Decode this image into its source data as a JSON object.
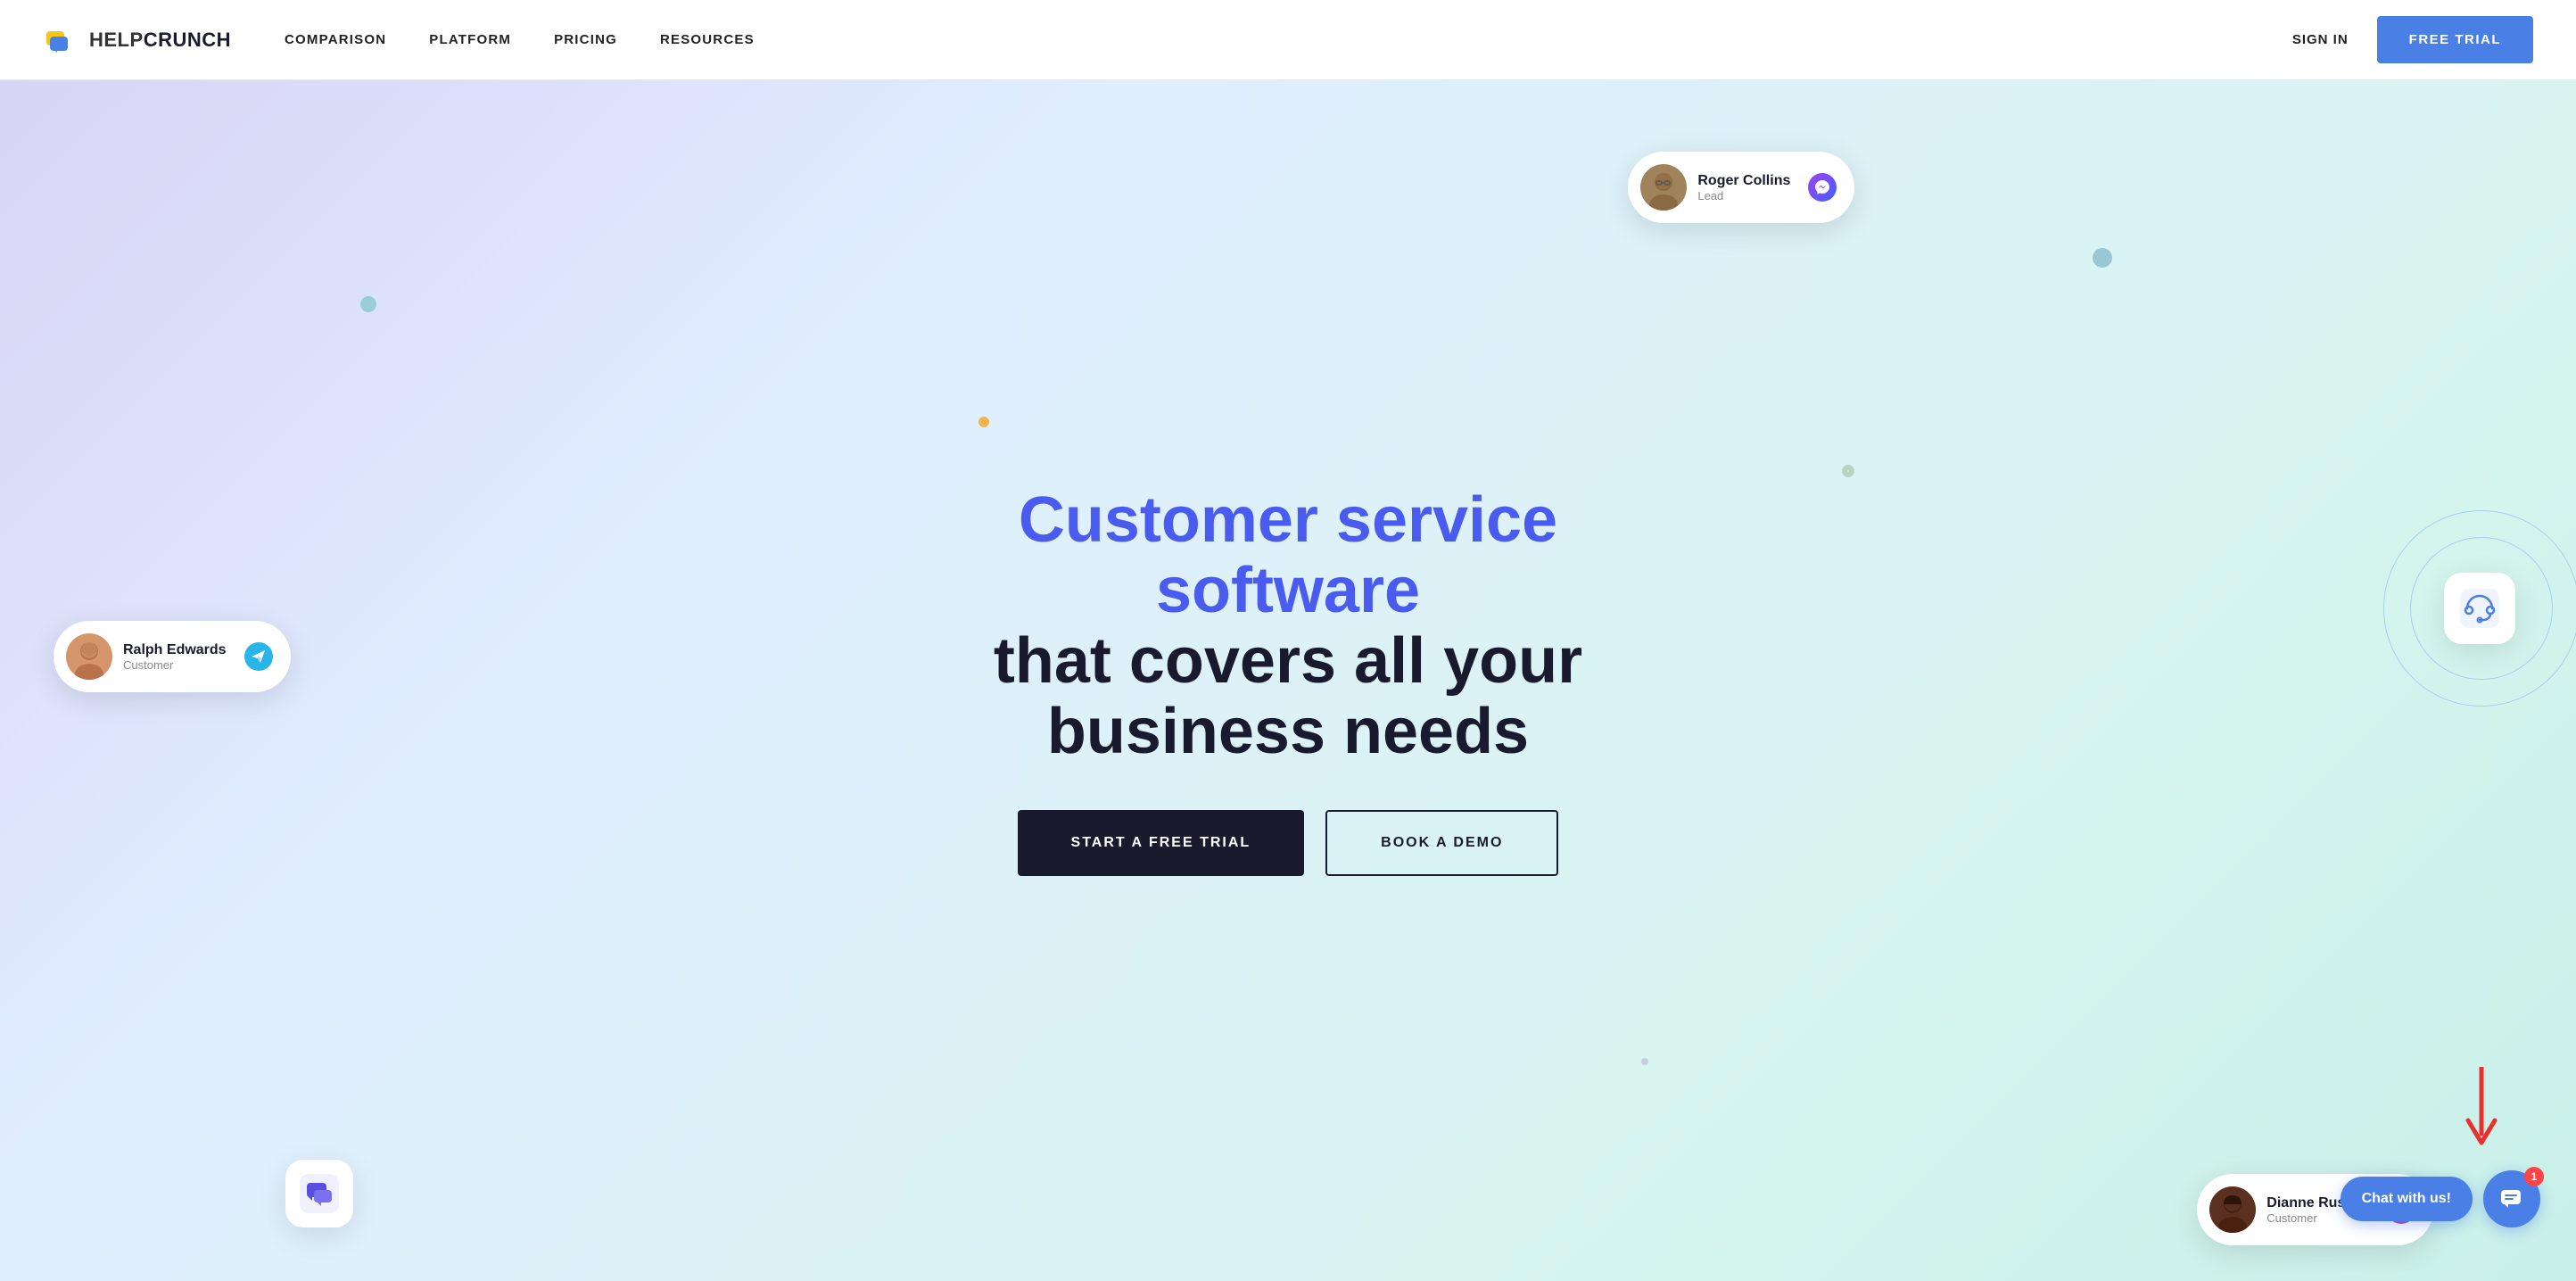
{
  "navbar": {
    "logo_text_help": "HELP",
    "logo_text_crunch": "CRUNCH",
    "nav_items": [
      {
        "label": "COMPARISON",
        "href": "#"
      },
      {
        "label": "PLATFORM",
        "href": "#"
      },
      {
        "label": "PRICING",
        "href": "#"
      },
      {
        "label": "RESOURCES",
        "href": "#"
      }
    ],
    "sign_in_label": "SIGN IN",
    "free_trial_label": "FREE TRIAL"
  },
  "hero": {
    "title_line1": "Customer service software",
    "title_line2": "that covers all your",
    "title_line3": "business needs",
    "cta_primary": "START A FREE TRIAL",
    "cta_secondary": "BOOK A DEMO"
  },
  "cards": {
    "ralph": {
      "name": "Ralph Edwards",
      "role": "Customer",
      "icon": "telegram",
      "avatar_emoji": "😊"
    },
    "roger": {
      "name": "Roger Collins",
      "role": "Lead",
      "icon": "messenger",
      "avatar_emoji": "👨"
    },
    "dianne": {
      "name": "Dianne Russell",
      "role": "Customer",
      "icon": "instagram",
      "avatar_emoji": "👩"
    }
  },
  "chat_widget": {
    "label": "Chat with us!",
    "badge_count": "1"
  },
  "dots": {
    "dot1": {
      "color": "#f5a623",
      "size": 12
    },
    "dot2": {
      "color": "#7bc8c8",
      "size": 16
    },
    "dot3": {
      "color": "#a8c8a8",
      "size": 14
    },
    "dot4": {
      "color": "#88bbcc",
      "size": 18
    },
    "dot5": {
      "color": "#ccc",
      "size": 10
    },
    "dot6": {
      "color": "#ccc",
      "size": 8
    }
  }
}
